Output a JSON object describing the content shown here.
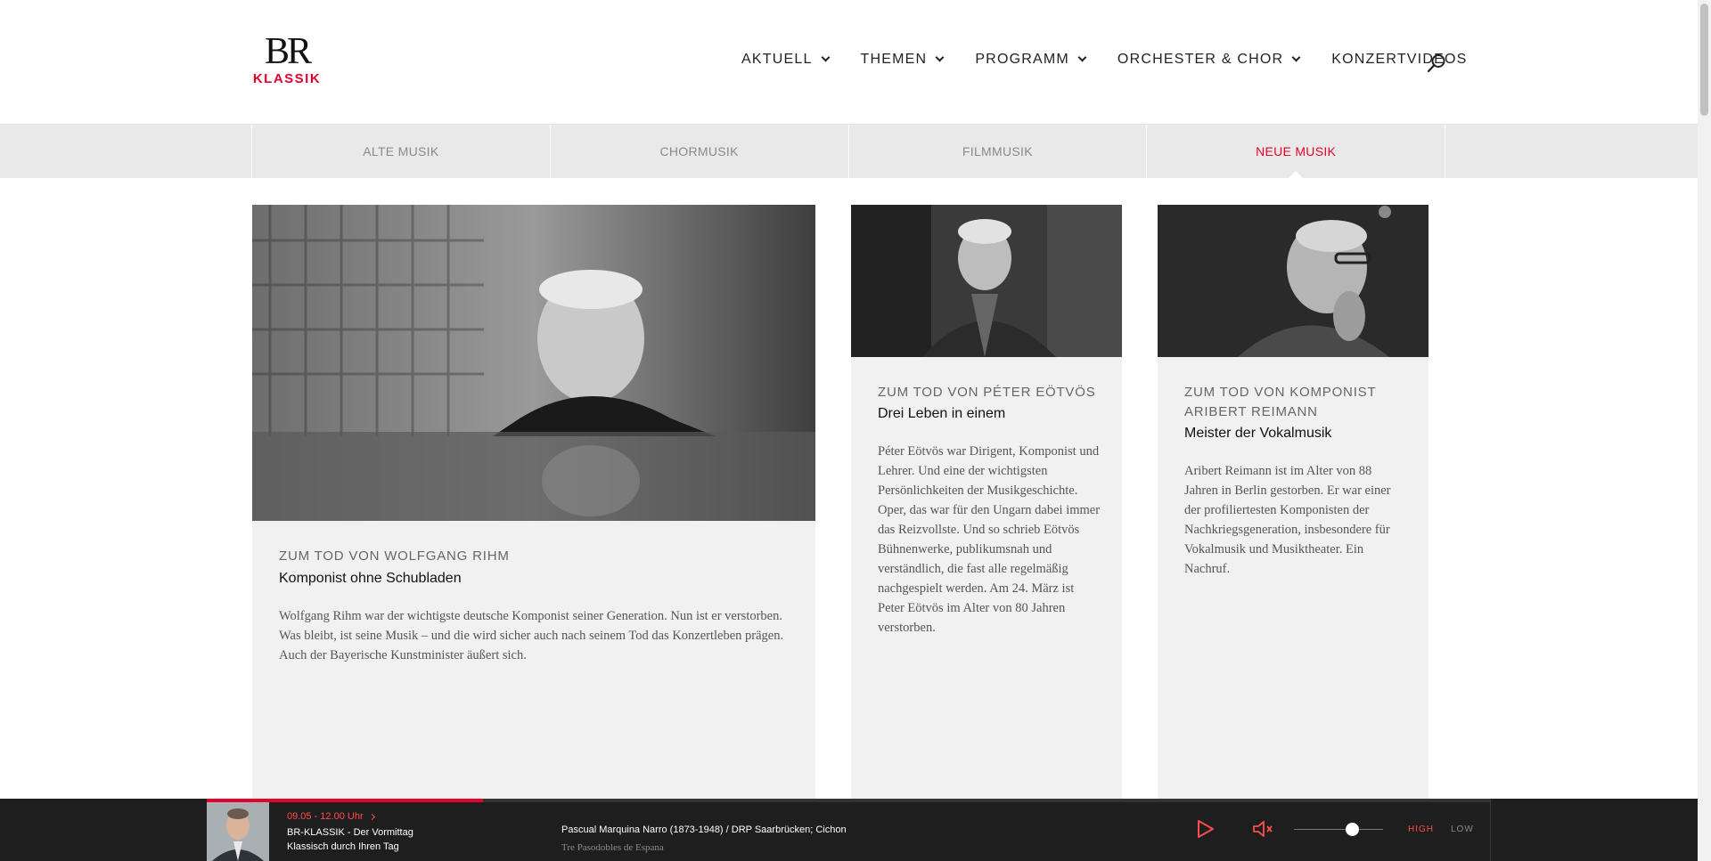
{
  "brand": {
    "logo_top": "BR",
    "logo_bottom": "KLASSIK",
    "accent": "#e4002b"
  },
  "nav": {
    "items": [
      {
        "label": "AKTUELL",
        "dropdown": true
      },
      {
        "label": "THEMEN",
        "dropdown": true
      },
      {
        "label": "PROGRAMM",
        "dropdown": true
      },
      {
        "label": "ORCHESTER & CHOR",
        "dropdown": true
      },
      {
        "label": "KONZERTVIDEOS",
        "dropdown": false
      }
    ],
    "search_icon": "search-icon"
  },
  "subtabs": {
    "items": [
      "ALTE MUSIK",
      "CHORMUSIK",
      "FILMMUSIK",
      "NEUE MUSIK"
    ],
    "active": "NEUE MUSIK"
  },
  "cards": [
    {
      "kicker": "ZUM TOD VON WOLFGANG RIHM",
      "title": "Komponist ohne Schubladen",
      "teaser": "Wolfgang Rihm war der wichtigste deutsche Komponist seiner Generation. Nun ist er verstorben. Was bleibt, ist seine Musik – und die wird sicher auch nach seinem Tod das Konzertleben prägen. Auch der Bayerische Kunstminister äußert sich.",
      "image": "portrait-photo"
    },
    {
      "kicker": "ZUM TOD VON PÉTER EÖTVÖS",
      "title": "Drei Leben in einem",
      "teaser": "Péter Eötvös war Dirigent, Komponist und Lehrer. Und eine der wichtigsten Persönlichkeiten der Musikgeschichte. Oper, das war für den Ungarn dabei immer das Reizvollste. Und so schrieb Eötvös Bühnenwerke, publikumsnah und verständlich, die fast alle regelmäßig nachgespielt werden. Am 24. März ist Peter Eötvös im Alter von 80 Jahren verstorben.",
      "image": "portrait-photo"
    },
    {
      "kicker": "ZUM TOD VON KOMPONIST ARIBERT REIMANN",
      "title": "Meister der Vokalmusik",
      "teaser": "Aribert Reimann ist im Alter von 88 Jahren in Berlin gestorben. Er war einer der profiliertesten Komponisten der Nachkriegsgeneration, insbesondere für Vokalmusik und Musiktheater. Ein Nachruf.",
      "image": "portrait-photo"
    }
  ],
  "player": {
    "time": "09.05 - 12.00 Uhr",
    "show_line1": "BR-KLASSIK - Der Vormittag",
    "show_line2": "Klassisch durch Ihren Tag",
    "track_line1": "Pascual Marquina Narro (1873-1948) / DRP Saarbrücken; Cichon",
    "track_line2": "Tre Pasodobles de Espana",
    "progress": 0.215,
    "volume": 0.65,
    "quality_high": "HIGH",
    "quality_low": "LOW",
    "quality_selected": "HIGH",
    "icons": [
      "play-icon",
      "speaker-icon"
    ]
  }
}
